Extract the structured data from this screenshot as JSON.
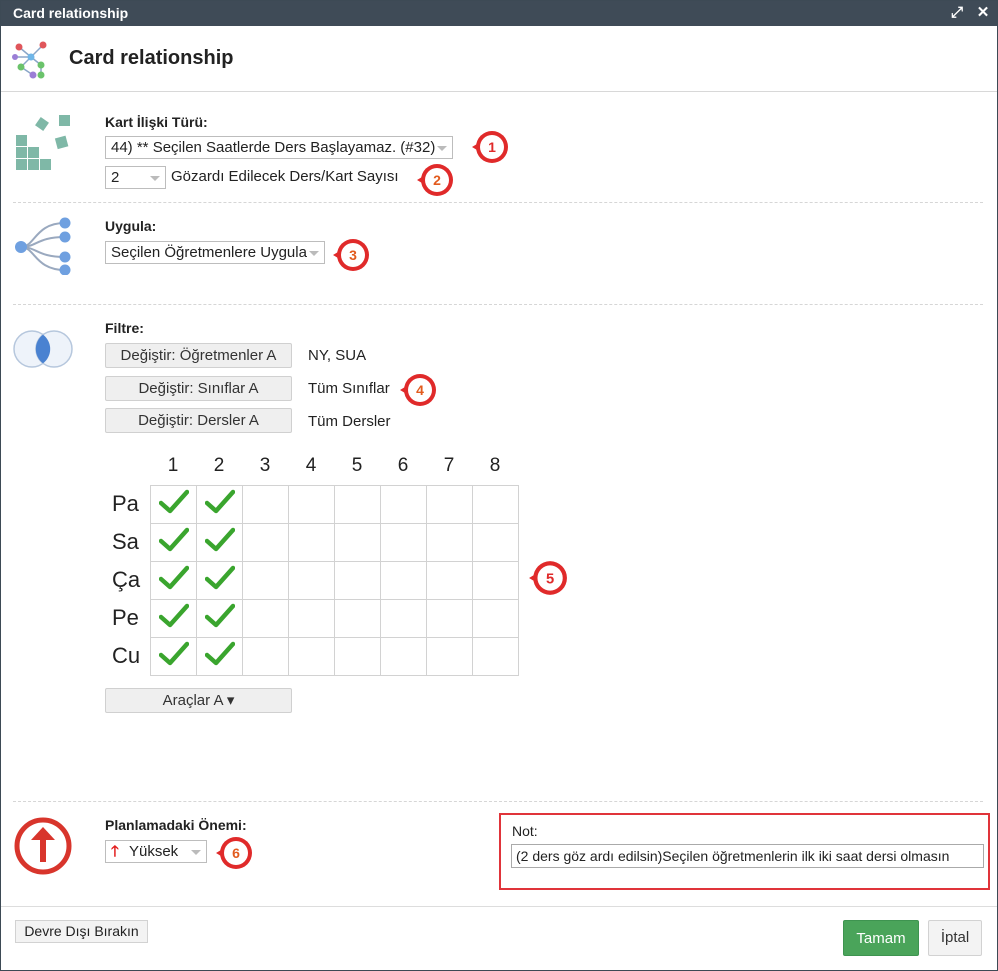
{
  "window": {
    "title": "Card relationship",
    "maximize_icon": "expand-icon",
    "close_icon": "close-icon"
  },
  "header": {
    "title": "Card relationship",
    "icon": "network-graph-icon"
  },
  "relation": {
    "label": "Kart İlişki Türü:",
    "type_value": "44) ** Seçilen Saatlerde Ders Başlayamaz. (#32)",
    "ignore_count_value": "2",
    "ignore_count_label": "Gözardı Edilecek Ders/Kart Sayısı",
    "icon": "cards-stack-icon"
  },
  "apply": {
    "label": "Uygula:",
    "value": "Seçilen Öğretmenlere Uygula",
    "icon": "branch-tree-icon"
  },
  "filter": {
    "label": "Filtre:",
    "icon": "venn-diagram-icon",
    "rows": [
      {
        "button": "Değiştir: Öğretmenler A",
        "value": "NY, SUA"
      },
      {
        "button": "Değiştir: Sınıflar A",
        "value": "Tüm Sınıflar"
      },
      {
        "button": "Değiştir: Dersler A",
        "value": "Tüm Dersler"
      }
    ]
  },
  "grid": {
    "columns": [
      "1",
      "2",
      "3",
      "4",
      "5",
      "6",
      "7",
      "8"
    ],
    "rows": [
      "Pa",
      "Sa",
      "Ça",
      "Pe",
      "Cu"
    ],
    "checked": [
      [
        true,
        true,
        false,
        false,
        false,
        false,
        false,
        false
      ],
      [
        true,
        true,
        false,
        false,
        false,
        false,
        false,
        false
      ],
      [
        true,
        true,
        false,
        false,
        false,
        false,
        false,
        false
      ],
      [
        true,
        true,
        false,
        false,
        false,
        false,
        false,
        false
      ],
      [
        true,
        true,
        false,
        false,
        false,
        false,
        false,
        false
      ]
    ],
    "check_icon": "checkmark-icon",
    "check_color": "#3aa52e",
    "tools_button": "Araçlar A ▾"
  },
  "importance": {
    "label": "Planlamadaki Önemi:",
    "value": "Yüksek",
    "icon": "arrow-up-circle-icon",
    "color": "#d8352c"
  },
  "note": {
    "label": "Not:",
    "value": "(2 ders göz ardı edilsin)Seçilen öğretmenlerin ilk iki saat dersi olmasın"
  },
  "badges": [
    "1",
    "2",
    "3",
    "4",
    "5",
    "6"
  ],
  "badge_color": "#e02a2a",
  "footer": {
    "disable_button": "Devre Dışı Bırakın",
    "ok_button": "Tamam",
    "cancel_button": "İptal",
    "ok_color": "#4aa45a"
  }
}
